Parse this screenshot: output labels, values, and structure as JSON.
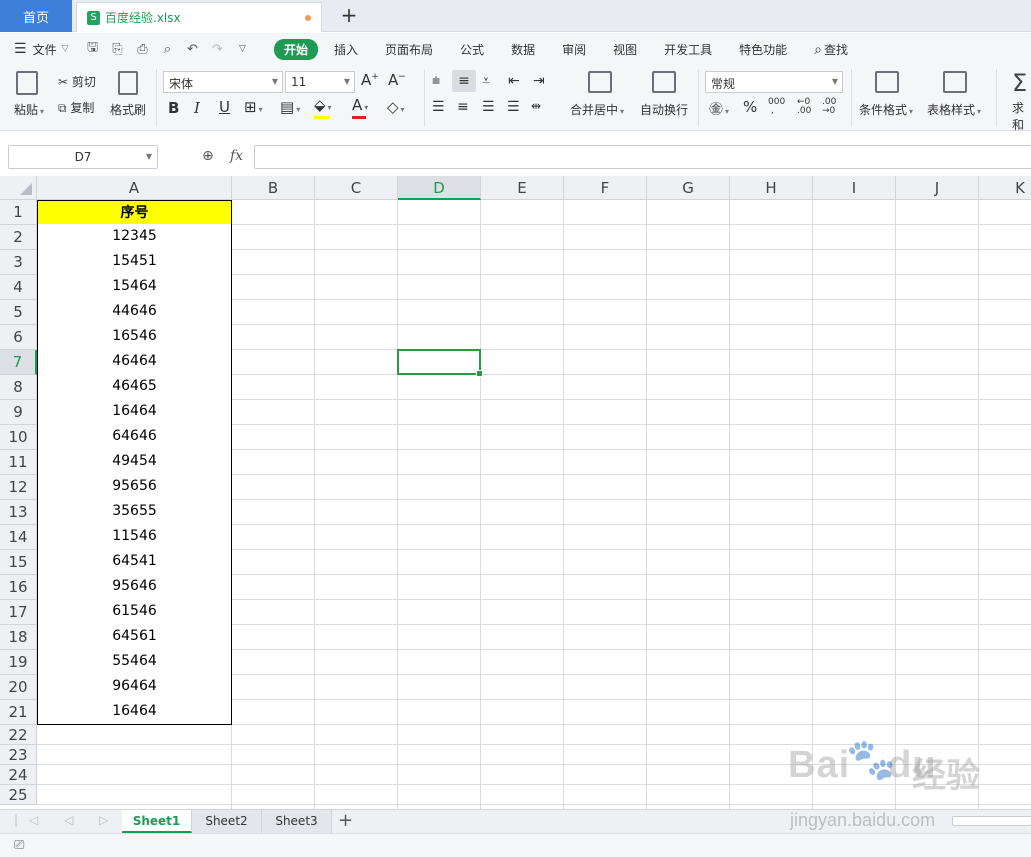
{
  "tabs": {
    "home": "首页",
    "file_icon": "S",
    "file_name": "百度经验.xlsx",
    "add": "+"
  },
  "menubar": {
    "file_label": "文件",
    "quick_icons": [
      "save-icon",
      "format-painter-icon",
      "print-icon",
      "print-preview-icon",
      "undo-icon",
      "redo-icon",
      "customize-icon"
    ],
    "items": [
      "开始",
      "插入",
      "页面布局",
      "公式",
      "数据",
      "审阅",
      "视图",
      "开发工具",
      "特色功能"
    ],
    "search": "查找"
  },
  "ribbon": {
    "paste": "粘贴",
    "cut": "剪切",
    "copy": "复制",
    "format_painter": "格式刷",
    "font_name": "宋体",
    "font_size": "11",
    "merge_center": "合并居中",
    "wrap_text": "自动换行",
    "number_format": "常规",
    "conditional_format": "条件格式",
    "table_style": "表格样式",
    "sum": "求和",
    "font_color": "#e02020",
    "fill_color": "#ffff00"
  },
  "formula_bar": {
    "cell_ref": "D7",
    "fx": "fx",
    "formula_value": ""
  },
  "grid": {
    "columns": [
      "A",
      "B",
      "C",
      "D",
      "E",
      "F",
      "G",
      "H",
      "I",
      "J",
      "K"
    ],
    "selected_column": "D",
    "selected_row": 7,
    "row_numbers": [
      "1",
      "2",
      "3",
      "4",
      "5",
      "6",
      "7",
      "8",
      "9",
      "10",
      "11",
      "12",
      "13",
      "14",
      "15",
      "16",
      "17",
      "18",
      "19",
      "20",
      "21",
      "22",
      "23",
      "24",
      "25"
    ],
    "header_fill": "#ffff00",
    "accent": "#1f9a53",
    "colA": [
      "序号",
      "12345",
      "15451",
      "15464",
      "44646",
      "16546",
      "46464",
      "46465",
      "16464",
      "64646",
      "49454",
      "95656",
      "35655",
      "11546",
      "64541",
      "95646",
      "61546",
      "64561",
      "55464",
      "96464",
      "16464"
    ]
  },
  "sheets": {
    "tabs": [
      "Sheet1",
      "Sheet2",
      "Sheet3"
    ],
    "active": "Sheet1",
    "add": "+"
  },
  "watermark": {
    "logo": "Bai",
    "logo2": "du",
    "cn": "经验",
    "url": "jingyan.baidu.com"
  }
}
